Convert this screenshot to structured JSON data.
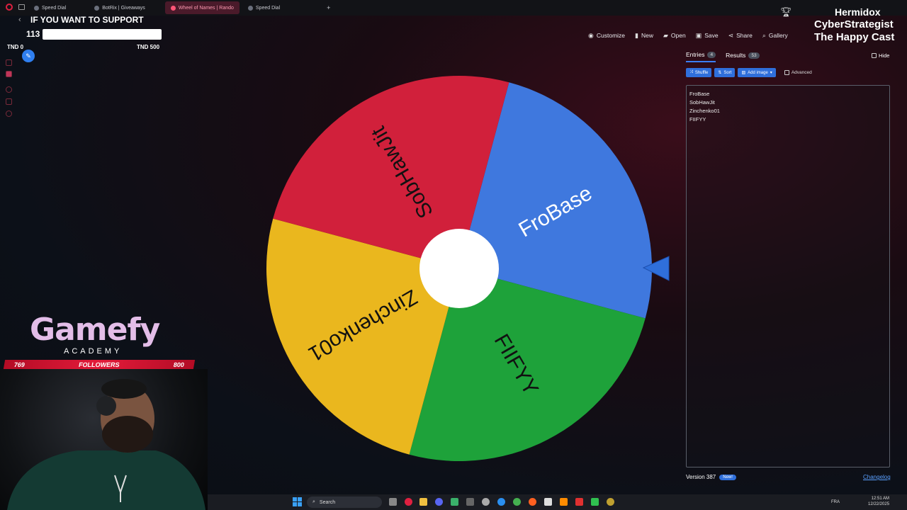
{
  "browser": {
    "tabs": [
      {
        "label": "Speed Dial",
        "active": false
      },
      {
        "label": "BotRix | Giveaways",
        "active": false
      },
      {
        "label": "Wheel of Names | Rando",
        "active": true
      },
      {
        "label": "Speed Dial",
        "active": false
      }
    ],
    "new_tab": "+"
  },
  "overlay": {
    "support_text": "IF YOU WANT TO SUPPORT",
    "goal_current": "113",
    "goal_min": "TND 0",
    "goal_max": "TND 500",
    "streamer": "Hermidox",
    "line1": "CyberStrategist",
    "line2": "The Happy Cast",
    "brand": "Gamefy",
    "brand_sub": "ACADEMY",
    "followers_current": "769",
    "followers_label": "FOLLOWERS",
    "followers_goal": "800"
  },
  "toolbar": {
    "customize": "Customize",
    "new": "New",
    "open": "Open",
    "save": "Save",
    "share": "Share",
    "gallery": "Gallery"
  },
  "wheel": {
    "segments": [
      {
        "label": "FroBase",
        "color": "#3f78de"
      },
      {
        "label": "FIIFYY",
        "color": "#1ea23a"
      },
      {
        "label": "Zinchenko01",
        "color": "#eab71e"
      },
      {
        "label": "SobHawJit",
        "color": "#d1203b"
      }
    ]
  },
  "panel": {
    "tab_entries": "Entries",
    "entries_count": "4",
    "tab_results": "Results",
    "results_count": "53",
    "hide": "Hide",
    "shuffle": "Shuffle",
    "sort": "Sort",
    "add_image": "Add image",
    "advanced": "Advanced",
    "entries": [
      "FroBase",
      "SobHawJit",
      "Zinchenko01",
      "FIIFYY"
    ],
    "version": "Version 387",
    "new_badge": "New!",
    "changelog": "Changelog"
  },
  "taskbar": {
    "search": "Search",
    "lang": "FRA",
    "time": "12:51 AM",
    "date": "12/22/2025"
  },
  "colors": {
    "accent": "#2f6fdb",
    "followers_bar": "#e31b3a"
  }
}
